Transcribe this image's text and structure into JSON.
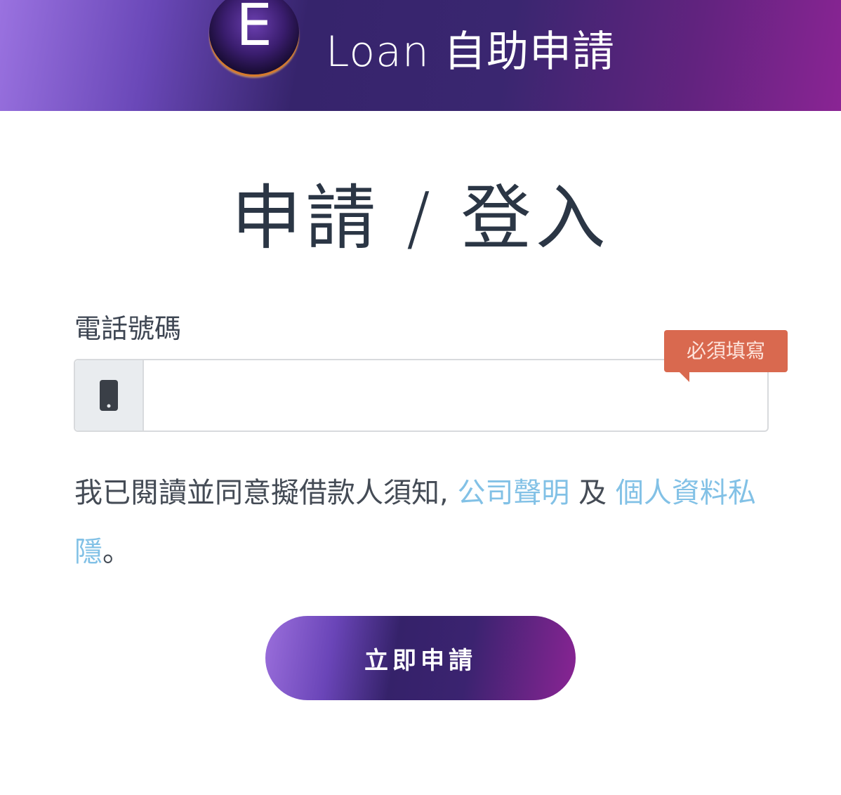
{
  "header": {
    "logo_letter": "E",
    "title": "Loan 自助申請"
  },
  "page_title": "申請 / 登入",
  "form": {
    "phone_label": "電話號碼",
    "phone_icon": "mobile-phone-icon",
    "phone_value": "",
    "phone_placeholder": "",
    "required_tooltip": "必須填寫"
  },
  "agreement": {
    "text_prefix": "我已閱讀並同意擬借款人須知,",
    "link_company": "公司聲明",
    "joiner": "及",
    "link_privacy": "個人資料私隱",
    "suffix": "。"
  },
  "apply_button": "立即申請",
  "colors": {
    "header_gradient": [
      "#9a72e0",
      "#36246c",
      "#8a2494"
    ],
    "tooltip_bg": "#d9694f",
    "link": "#82c1e6",
    "title_text": "#2b3645"
  }
}
